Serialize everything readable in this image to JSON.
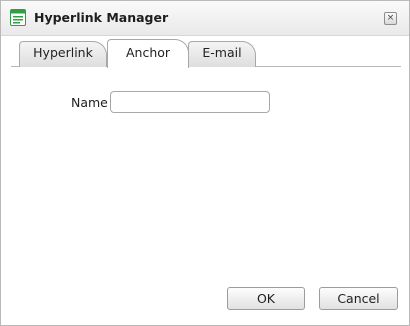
{
  "window": {
    "title": "Hyperlink Manager",
    "close_icon": "close-icon",
    "app_icon": "document-list-icon"
  },
  "tabs": [
    {
      "label": "Hyperlink",
      "active": false
    },
    {
      "label": "Anchor",
      "active": true
    },
    {
      "label": "E-mail",
      "active": false
    }
  ],
  "form": {
    "name_label": "Name",
    "name_value": "",
    "name_placeholder": ""
  },
  "buttons": {
    "ok": "OK",
    "cancel": "Cancel"
  },
  "colors": {
    "icon_green": "#2f9e44",
    "border": "#a8a8a8",
    "titlebar_bg": "#f0f0f0"
  }
}
